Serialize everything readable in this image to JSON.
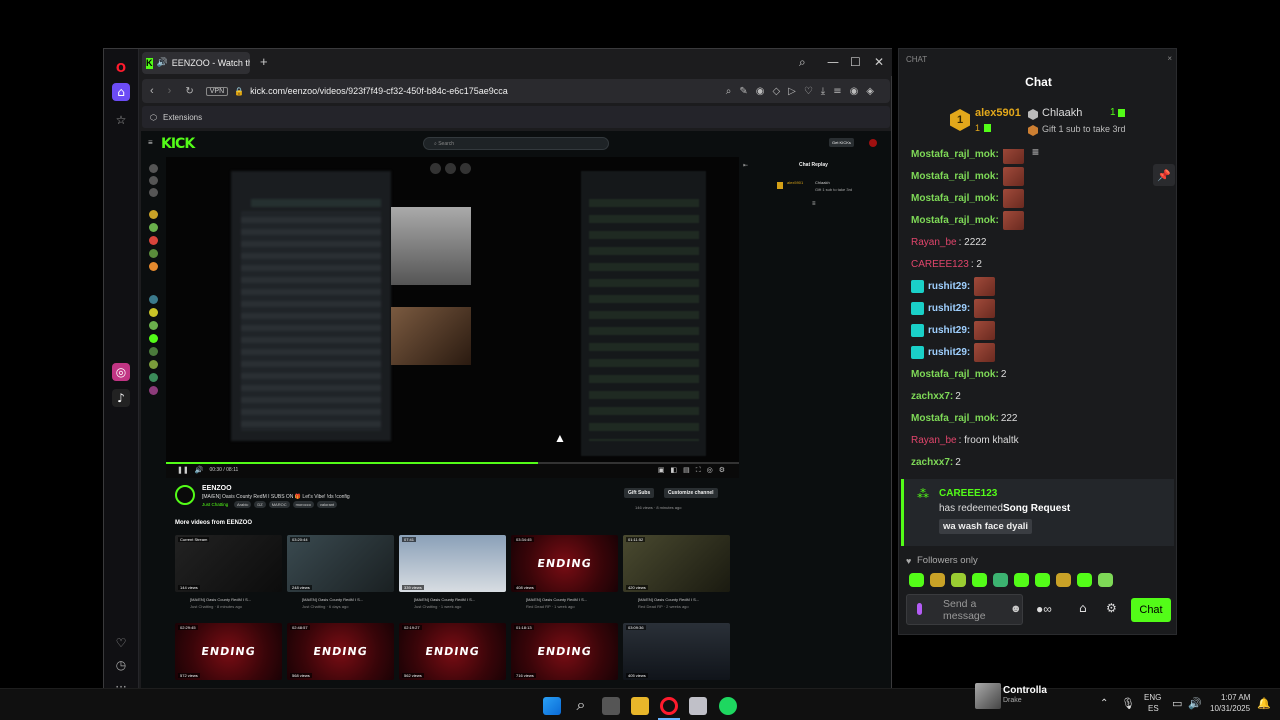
{
  "browser": {
    "tab_title": "EENZOO - Watch the",
    "url": "kick.com/eenzoo/videos/923f7f49-cf32-450f-b84c-e6c175ae9cca",
    "vpn_label": "VPN",
    "extensions_label": "Extensions"
  },
  "kick": {
    "logo": "KICK",
    "search_placeholder": "Search",
    "get_kicks": "Get KICKs",
    "chat_replay_title": "Chat Replay",
    "replay_user": "alex5901",
    "replay_user2": "Chlaakh",
    "replay_gift": "Gift 1 sub to take 3rd",
    "player_time": "00:30 / 08:11",
    "channel_name": "EENZOO",
    "stream_title": "[MA/EN] Oasis County RedM I SUBS ON 🎁 Let's Vibe! !ds !config",
    "category": "Just Chatting",
    "tags": [
      "Arabic",
      "DZ",
      "MAROC",
      "morocco",
      "valorant"
    ],
    "gift_subs": "Gift Subs",
    "customize": "Customize channel",
    "views_meta": "146 views · 8 minutes ago",
    "more_videos_title": "More videos from EENZOO",
    "videos_row1": [
      {
        "dur": "Current Stream",
        "views": "144 views",
        "caption": "[MA/EN] Oasis County RedM I S...",
        "sub": "Just Chatting · 8 minutes ago"
      },
      {
        "dur": "03:20:44",
        "views": "248 views",
        "caption": "[MA/EN] Oasis County RedM I S...",
        "sub": "Just Chatting · 6 days ago"
      },
      {
        "dur": "07:41",
        "views": "339 views",
        "caption": "[MA/EN] Oasis County RedM I S...",
        "sub": "Just Chatting · 1 week ago"
      },
      {
        "dur": "03:34:45",
        "views": "408 views",
        "caption": "[MA/EN] Oasis County RedM I S...",
        "sub": "Red Dead RP · 1 week ago"
      },
      {
        "dur": "01:11:52",
        "views": "420 views",
        "caption": "[MA/EN] Oasis County RedM I S...",
        "sub": "Red Dead RP · 2 weeks ago"
      }
    ],
    "videos_row2": [
      {
        "dur": "02:29:45",
        "views": "572 views"
      },
      {
        "dur": "02:48:57",
        "views": "568 views"
      },
      {
        "dur": "02:19:27",
        "views": "562 views"
      },
      {
        "dur": "01:18:13",
        "views": "716 views"
      },
      {
        "dur": "03:09:36",
        "views": "405 views"
      }
    ],
    "ending_text": "ENDING"
  },
  "chat": {
    "window_label": "CHAT",
    "title": "Chat",
    "top_gifter": "alex5901",
    "top_gifter_count": "1",
    "second": "Chlaakh",
    "second_count": "1",
    "gift_prompt": "Gift 1 sub to take 3rd",
    "messages": [
      {
        "user": "Mostafa_rajl_mok:",
        "text": "",
        "emote": true,
        "color": "#7ed957"
      },
      {
        "user": "Mostafa_rajl_mok:",
        "text": "",
        "emote": true,
        "color": "#7ed957"
      },
      {
        "user": "Mostafa_rajl_mok:",
        "text": "",
        "emote": true,
        "color": "#7ed957"
      },
      {
        "user": "Rayan_be",
        "text": ": 2222",
        "emote": false,
        "color": "#e0456b"
      },
      {
        "user": "CAREEE123",
        "text": ": 2",
        "emote": false,
        "color": "#e0456b"
      },
      {
        "user": "rushit29:",
        "text": "",
        "emote": true,
        "color": "#9fd0ff",
        "badge": true
      },
      {
        "user": "rushit29:",
        "text": "",
        "emote": true,
        "color": "#9fd0ff",
        "badge": true
      },
      {
        "user": "rushit29:",
        "text": "",
        "emote": true,
        "color": "#9fd0ff",
        "badge": true
      },
      {
        "user": "rushit29:",
        "text": "",
        "emote": true,
        "color": "#9fd0ff",
        "badge": true
      },
      {
        "user": "Mostafa_rajl_mok:",
        "text": " 2",
        "emote": false,
        "color": "#7ed957"
      },
      {
        "user": "zachxx7:",
        "text": " 2",
        "emote": false,
        "color": "#7ed957"
      },
      {
        "user": "Mostafa_rajl_mok:",
        "text": " 222",
        "emote": false,
        "color": "#7ed957"
      },
      {
        "user": "Rayan_be",
        "text": ": froom khaltk",
        "emote": false,
        "color": "#e0456b"
      },
      {
        "user": "zachxx7:",
        "text": " 2",
        "emote": false,
        "color": "#7ed957"
      }
    ],
    "redeem_user": "CAREEE123",
    "redeem_text": "has redeemed",
    "redeem_item": "Song Request",
    "redeem_msg": "wa wash face dyali",
    "followers_only": "Followers only",
    "input_placeholder": "Send a message",
    "send_label": "Chat"
  },
  "taskbar": {
    "media_title": "Controlla",
    "media_artist": "Drake",
    "lang1": "ENG",
    "lang2": "ES",
    "time": "1:07 AM",
    "date": "10/31/2025"
  },
  "colors": {
    "kick_green": "#53fc18",
    "chat_bg": "#1a1b1d"
  }
}
